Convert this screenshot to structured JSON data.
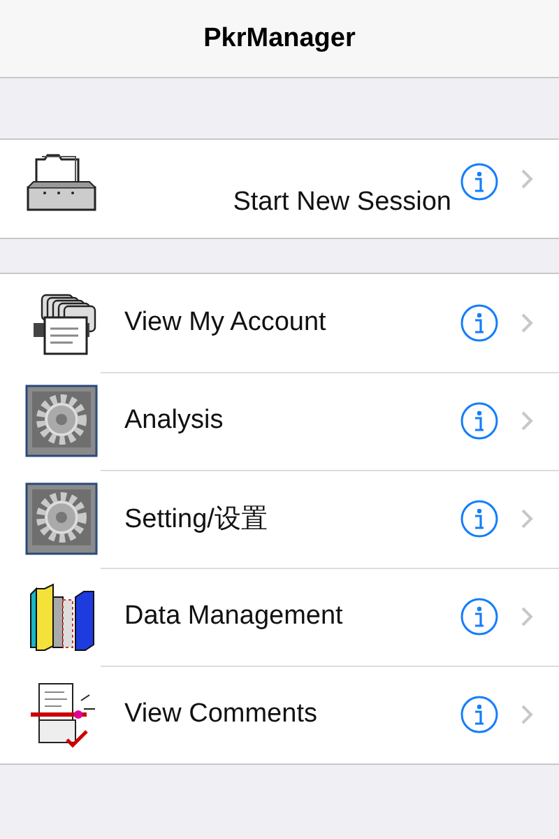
{
  "nav_bar": {
    "title": "PkrManager"
  },
  "sections": [
    {
      "kind": "single",
      "rows": [
        {
          "label": "Start New Session",
          "kind": "file-tray"
        }
      ]
    },
    {
      "kind": "list",
      "rows": [
        {
          "label": "View My Account",
          "kind": "card-file"
        },
        {
          "label": "Analysis",
          "kind": "gear-panel"
        },
        {
          "label": "Setting/设置",
          "kind": "gear-panel"
        },
        {
          "label": "Data Management",
          "kind": "books"
        },
        {
          "label": "View Comments",
          "kind": "notes"
        }
      ]
    }
  ]
}
